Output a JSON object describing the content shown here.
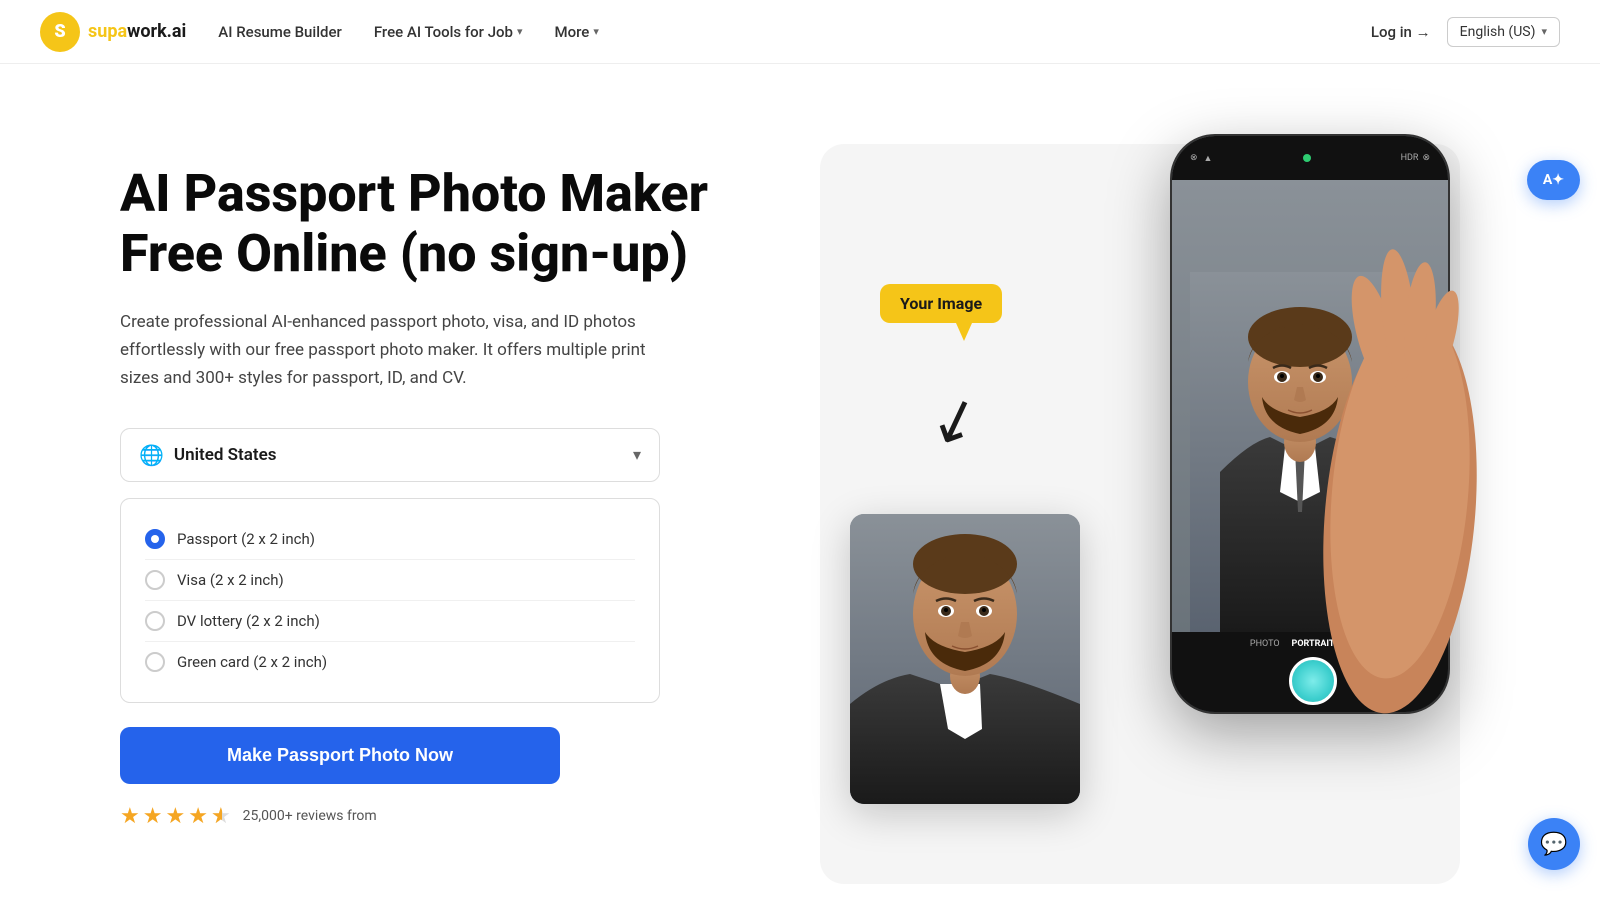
{
  "navbar": {
    "logo_text": "supawork.ai",
    "nav_items": [
      {
        "label": "AI Resume Builder",
        "has_dropdown": false
      },
      {
        "label": "Free AI Tools for Job",
        "has_dropdown": true
      },
      {
        "label": "More",
        "has_dropdown": true
      }
    ],
    "login_label": "Log in →",
    "language_label": "English (US)"
  },
  "hero": {
    "title": "AI Passport Photo Maker Free Online (no sign-up)",
    "description": "Create professional AI-enhanced passport photo, visa, and ID photos effortlessly with our free passport photo maker. It offers multiple print sizes and 300+ styles for passport, ID, and CV.",
    "country_selector": {
      "label": "United States"
    },
    "options": [
      {
        "label": "Passport (2 x 2 inch)",
        "selected": true
      },
      {
        "label": "Visa (2 x 2 inch)",
        "selected": false
      },
      {
        "label": "DV lottery (2 x 2 inch)",
        "selected": false
      },
      {
        "label": "Green card (2 x 2 inch)",
        "selected": false
      }
    ],
    "cta_label": "Make Passport Photo Now",
    "reviews": {
      "count_text": "25,000+ reviews from",
      "rating": 4.5
    }
  },
  "illustration": {
    "your_image_label": "Your Image"
  },
  "ai_badge": {
    "label": "AI✦"
  }
}
